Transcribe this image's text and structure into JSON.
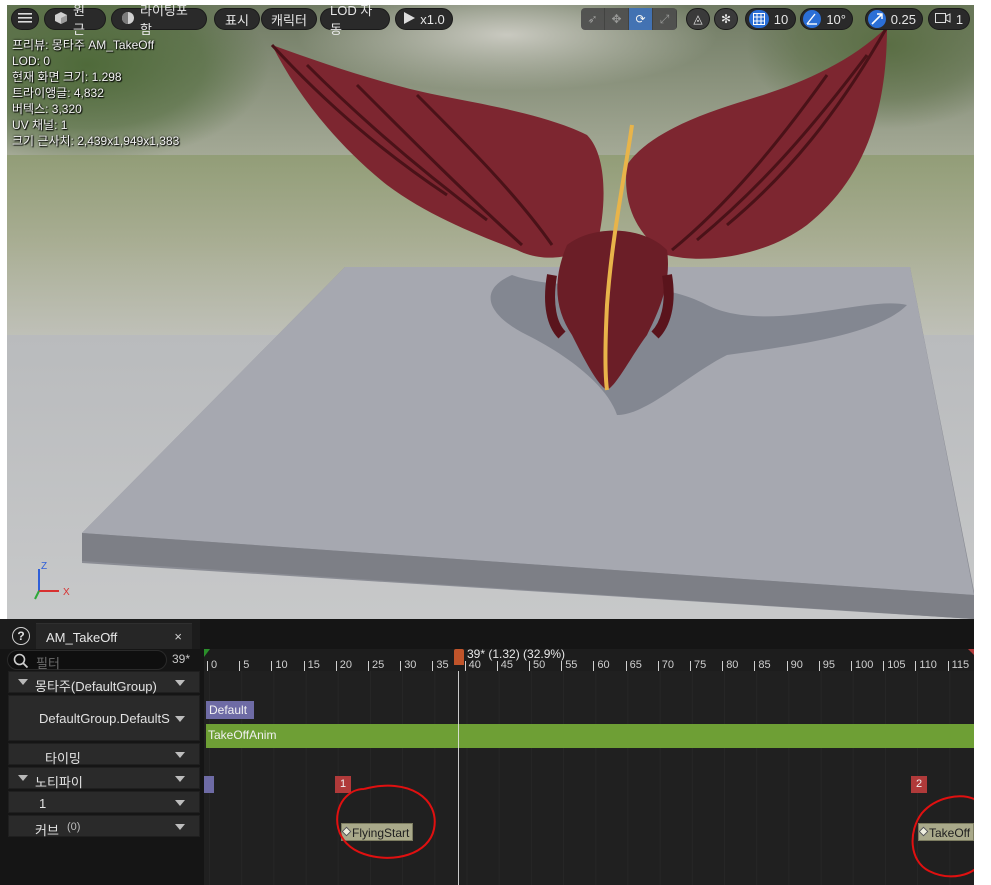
{
  "toolbar": {
    "menu_icon": "hamburger-icon",
    "perspective_label": "원근",
    "lighting_label": "라이팅포함",
    "show_label": "표시",
    "character_label": "캐릭터",
    "lod_label": "LOD 자동",
    "play_speed_label": "x1.0",
    "grid_snap_value": "10",
    "rotation_snap_value": "10°",
    "scale_snap_value": "0.25",
    "camera_speed_value": "1",
    "accent_color": "#2b6fd6"
  },
  "stats": {
    "preview": "프리뷰: 몽타주 AM_TakeOff",
    "lod": "LOD: 0",
    "screen_size": "현재 화면 크기: 1.298",
    "triangles": "트라이앵글: 4,832",
    "vertices": "버텍스: 3,320",
    "uv_channels": "UV 채널: 1",
    "approx_size": "크기 근사치: 2,439x1,949x1,383"
  },
  "axis": {
    "z": "Z",
    "x": "X"
  },
  "panel": {
    "tab_label": "AM_TakeOff",
    "close_glyph": "×",
    "help_glyph": "?",
    "filter_placeholder": "필터",
    "frame_count": "39*",
    "tracks": [
      {
        "label": "몽타주(DefaultGroup)"
      },
      {
        "label": "DefaultGroup.DefaultS"
      },
      {
        "label": "타이밍"
      },
      {
        "label": "노티파이"
      },
      {
        "label": "1"
      },
      {
        "label": "커브",
        "count": "(0)"
      }
    ]
  },
  "timeline": {
    "ticks": [
      "0",
      "5",
      "10",
      "15",
      "20",
      "25",
      "30",
      "35",
      "40",
      "45",
      "50",
      "55",
      "60",
      "65",
      "70",
      "75",
      "80",
      "85",
      "90",
      "95",
      "100",
      "105",
      "110",
      "115"
    ],
    "playhead_label": "39* (1.32) (32.9%)",
    "slot_label": "Default",
    "anim_segment": "TakeOffAnim",
    "sections": [
      "1",
      "2"
    ],
    "notifies": [
      "FlyingStart",
      "TakeOff"
    ],
    "colors": {
      "slot": "#6e6ba5",
      "anim": "#6e9f35",
      "section": "#b03a3a",
      "notify": "#a9a98a",
      "annotation": "#e01010"
    }
  }
}
